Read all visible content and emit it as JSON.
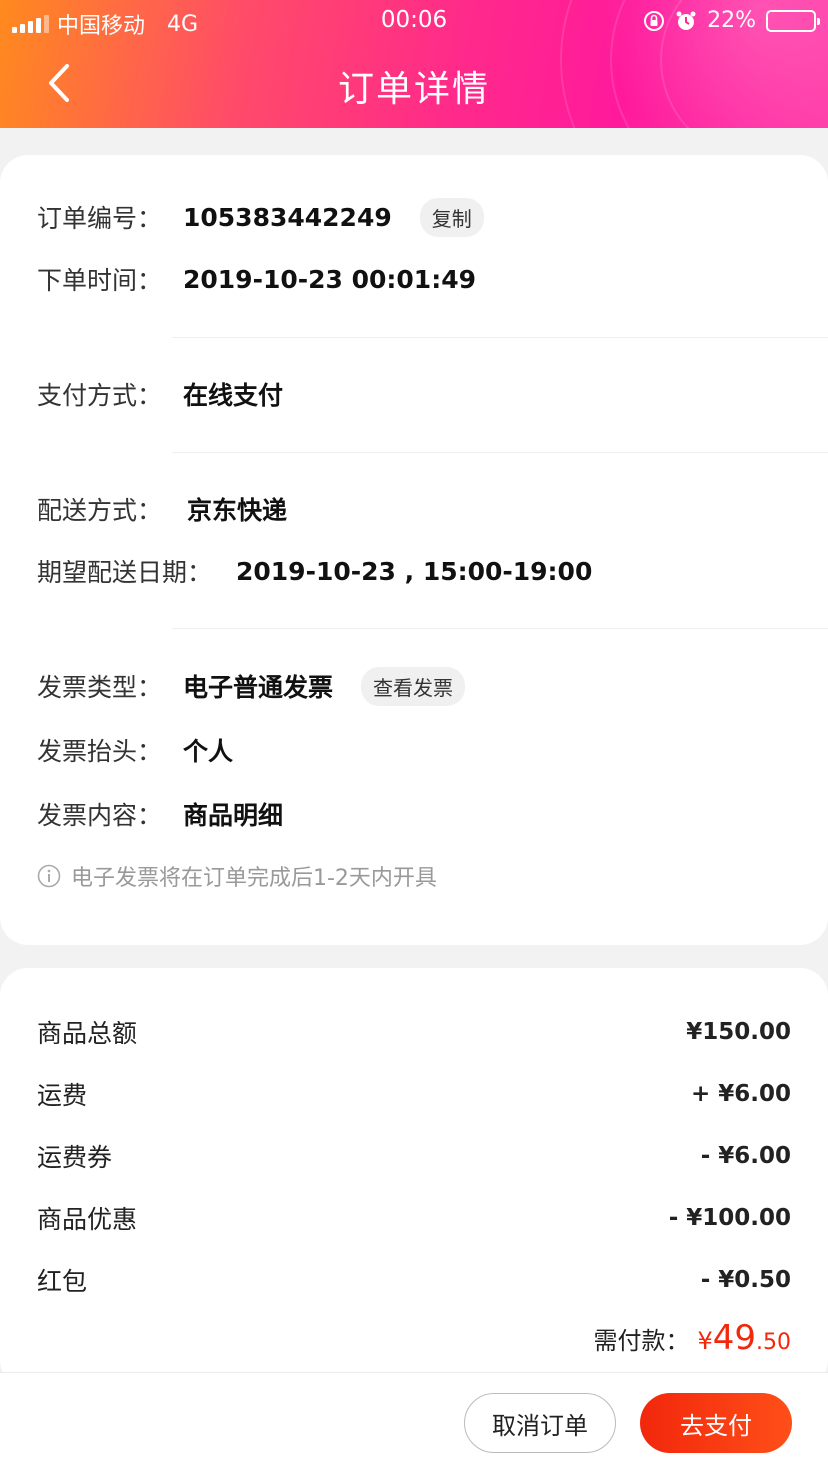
{
  "status_bar": {
    "carrier": "中国移动",
    "network": "4G",
    "time": "00:06",
    "battery": "22%",
    "battery_level": 0.22
  },
  "header": {
    "title": "订单详情"
  },
  "order": {
    "number_label": "订单编号：",
    "number": "105383442249",
    "copy_label": "复制",
    "time_label": "下单时间：",
    "time": "2019-10-23 00:01:49",
    "payment_label": "支付方式：",
    "payment": "在线支付",
    "delivery_label": "配送方式：",
    "delivery": "京东快递",
    "expected_label": "期望配送日期：",
    "expected": "2019-10-23 , 15:00-19:00",
    "invoice_type_label": "发票类型：",
    "invoice_type": "电子普通发票",
    "view_invoice_label": "查看发票",
    "invoice_title_label": "发票抬头：",
    "invoice_title": "个人",
    "invoice_content_label": "发票内容：",
    "invoice_content": "商品明细",
    "invoice_note": "电子发票将在订单完成后1-2天内开具"
  },
  "amounts": {
    "items": [
      {
        "label": "商品总额",
        "value": "¥150.00"
      },
      {
        "label": "运费",
        "value": "+ ¥6.00"
      },
      {
        "label": "运费券",
        "value": "- ¥6.00"
      },
      {
        "label": "商品优惠",
        "value": "- ¥100.00"
      },
      {
        "label": "红包",
        "value": "- ¥0.50"
      }
    ],
    "total_label": "需付款：",
    "total_yen": "¥",
    "total_int": "49",
    "total_dec": ".50"
  },
  "actions": {
    "cancel": "取消订单",
    "pay": "去支付"
  }
}
